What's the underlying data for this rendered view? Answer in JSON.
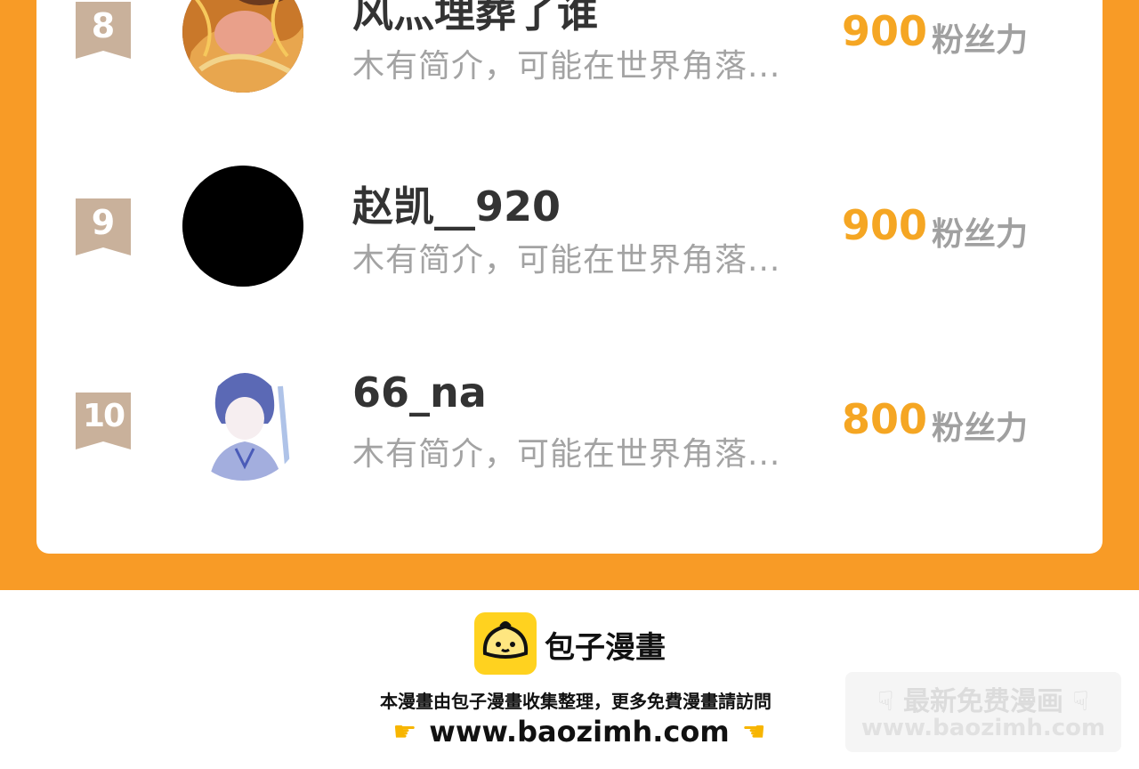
{
  "ranking": {
    "rows": [
      {
        "rank": "8",
        "name": "风灬埋葬了谁",
        "bio": "木有简介，可能在世界角落...",
        "score": "900",
        "unit": "粉丝力",
        "avatar": "dragon-art-avatar"
      },
      {
        "rank": "9",
        "name": "赵凯__920",
        "bio": "木有简介，可能在世界角落...",
        "score": "900",
        "unit": "粉丝力",
        "avatar": "black-circle-avatar"
      },
      {
        "rank": "10",
        "name": "66_na",
        "bio": "木有简介，可能在世界角落...",
        "score": "800",
        "unit": "粉丝力",
        "avatar": "anime-boy-sketch-avatar"
      }
    ]
  },
  "footer": {
    "brand": "包子漫畫",
    "note": "本漫畫由包子漫畫收集整理，更多免費漫畫請訪問",
    "url": "www.baozimh.com",
    "left_hand_icon": "pointing-right-hand-icon",
    "right_hand_icon": "pointing-left-hand-icon"
  },
  "watermark": {
    "title": "最新免费漫画",
    "url": "www.baozimh.com",
    "icon": "pointing-down-hand-icon"
  },
  "colors": {
    "accent_orange": "#F89B26",
    "score_yellow": "#F5A623",
    "rank_ribbon": "#C9B19B",
    "logo_yellow": "#FFD21F"
  }
}
